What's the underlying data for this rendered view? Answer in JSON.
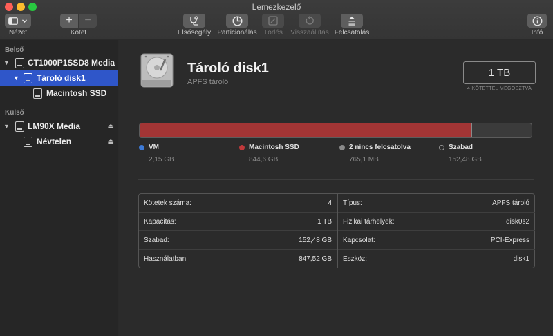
{
  "window": {
    "title": "Lemezkezelő"
  },
  "toolbar": {
    "view_label": "Nézet",
    "volume_label": "Kötet",
    "add_symbol": "+",
    "remove_symbol": "−",
    "first_aid_label": "Elsősegély",
    "partition_label": "Particionálás",
    "erase_label": "Törlés",
    "restore_label": "Visszaállítás",
    "mount_label": "Felcsatolás",
    "info_label": "Infó"
  },
  "sidebar": {
    "internal_title": "Belső",
    "external_title": "Külső",
    "items": [
      {
        "label": "CT1000P1SSD8 Media"
      },
      {
        "label": "Tároló disk1"
      },
      {
        "label": "Macintosh SSD"
      },
      {
        "label": "LM90X Media"
      },
      {
        "label": "Névtelen"
      }
    ],
    "eject_symbol": "⏏"
  },
  "disk": {
    "title": "Tároló disk1",
    "subtitle": "APFS tároló",
    "capacity": "1 TB",
    "capacity_note": "4 KÖTETTEL MEGOSZTVA"
  },
  "usage": {
    "segments": [
      {
        "name": "VM",
        "fraction": 0.0022,
        "color": "#3d7ad6"
      },
      {
        "name": "Macintosh SSD",
        "fraction": 0.8446,
        "color": "#a33535"
      },
      {
        "name": "2 nincs felcsatolva",
        "fraction": 0.0008,
        "color": "#8a8a8a"
      }
    ],
    "legend": [
      {
        "name": "VM",
        "value": "2,15 GB",
        "color": "#3d7ad6"
      },
      {
        "name": "Macintosh SSD",
        "value": "844,6 GB",
        "color": "#c0393b"
      },
      {
        "name": "2 nincs felcsatolva",
        "value": "765,1 MB",
        "color": "#8a8a8a"
      },
      {
        "name": "Szabad",
        "value": "152,48 GB",
        "color": "#2b2b2b"
      }
    ]
  },
  "info": {
    "left": [
      {
        "key": "Kötetek száma:",
        "value": "4"
      },
      {
        "key": "Kapacitás:",
        "value": "1 TB"
      },
      {
        "key": "Szabad:",
        "value": "152,48 GB"
      },
      {
        "key": "Használatban:",
        "value": "847,52 GB"
      }
    ],
    "right": [
      {
        "key": "Típus:",
        "value": "APFS tároló"
      },
      {
        "key": "Fizikai tárhelyek:",
        "value": "disk0s2"
      },
      {
        "key": "Kapcsolat:",
        "value": "PCI-Express"
      },
      {
        "key": "Eszköz:",
        "value": "disk1"
      }
    ]
  }
}
